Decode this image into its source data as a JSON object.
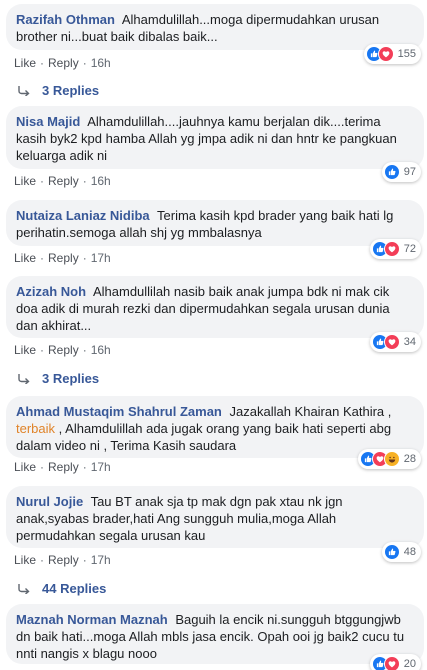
{
  "labels": {
    "like": "Like",
    "reply": "Reply"
  },
  "comments": [
    {
      "author": "Razifah Othman",
      "text": "Alhamdulillah...moga dipermudahkan urusan brother ni...buat baik dibalas baik...",
      "time": "16h",
      "count": "155",
      "reactions": [
        "like",
        "love"
      ]
    },
    {
      "author": "Nisa Majid",
      "text": "Alhamdulillah....jauhnya kamu berjalan dik....terima kasih byk2 kpd hamba Allah yg jmpa adik ni dan hntr ke pangkuan keluarga adik ni",
      "time": "16h",
      "count": "97",
      "reactions": [
        "like"
      ]
    },
    {
      "author": "Nutaiza Laniaz Nidiba",
      "text": "Terima kasih kpd brader yang baik hati lg perihatin.semoga allah shj yg mmbalasnya",
      "time": "17h",
      "count": "72",
      "reactions": [
        "like",
        "love"
      ]
    },
    {
      "author": "Azizah Noh",
      "text": "Alhamdullilah nasib baik anak jumpa bdk ni mak cik doa adik di murah rezki dan dipermudahkan segala urusan dunia dan akhirat...",
      "time": "16h",
      "count": "34",
      "reactions": [
        "like",
        "love"
      ]
    },
    {
      "author": "Ahmad Mustaqim Shahrul Zaman",
      "text_before": "Jazakallah Khairan Kathira ,",
      "highlight": "terbaik",
      "text_after": ", Alhamdulillah ada jugak orang yang baik hati seperti abg dalam video ni , Terima Kasih saudara",
      "time": "17h",
      "count": "28",
      "reactions": [
        "like",
        "love",
        "haha"
      ]
    },
    {
      "author": "Nurul Jojie",
      "text": "Tau BT anak sja tp mak dgn pak xtau nk jgn anak,syabas brader,hati Ang sungguh mulia,moga Allah permudahkan segala urusan kau",
      "time": "17h",
      "count": "48",
      "reactions": [
        "like"
      ]
    },
    {
      "author": "Maznah Norman Maznah",
      "text": "Baguih la encik ni.sungguh btggungjwb dn baik hati...moga Allah mbls jasa encik. Opah ooi jg baik2 cucu tu nnti nangis x blagu nooo",
      "count": "20",
      "reactions": [
        "like",
        "love"
      ]
    }
  ],
  "reply_threads": [
    {
      "label": "3 Replies"
    },
    {
      "label": "3 Replies"
    },
    {
      "label": "44 Replies"
    }
  ],
  "colors": {
    "author": "#385898",
    "highlight": "#e0842a",
    "bubble": "#f2f3f5",
    "like": "#1877f2",
    "love": "#f33e58",
    "haha": "#f7b125"
  }
}
